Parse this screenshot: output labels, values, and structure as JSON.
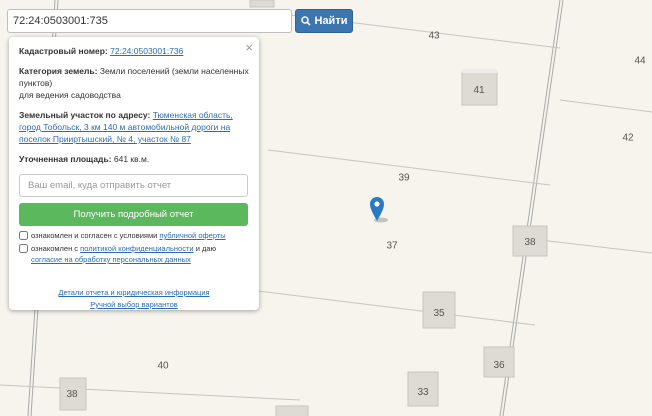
{
  "search": {
    "value": "72:24:0503001:735",
    "button_label": "Найти"
  },
  "popup": {
    "cadastral_label": "Кадастровый номер:",
    "cadastral_value": "72:24:0503001:736",
    "category_label": "Категория земель:",
    "category_value": "Земли поселений (земли населенных пунктов)",
    "category_usage": "для ведения садоводства",
    "address_label": "Земельный участок по адресу:",
    "address_value": "Тюменская область, город Тобольск, 3 км 140 м автомобильной дороги на поселок Прииртышский, № 4, участок № 87",
    "area_label": "Уточненная площадь:",
    "area_value": "641 кв.м.",
    "email_placeholder": "Ваш email, куда отправить отчет",
    "report_button": "Получить подробный отчет",
    "check1_text": "ознакомлен и согласен с условиями",
    "check1_link": "публичной оферты",
    "check2_text": "ознакомлен с",
    "check2_link": "политикой конфиденциальности",
    "check2_middle": "и даю",
    "check2_link2": "согласие на обработку персональных данных",
    "link_details": "Детали отчета и юридическая информация",
    "link_manual": "Ручной выбор вариантов"
  },
  "map": {
    "plot_numbers": [
      "43",
      "44",
      "42",
      "39",
      "37",
      "40"
    ],
    "building_numbers": [
      "41",
      "38",
      "35",
      "36",
      "33",
      "38"
    ],
    "marker_color": "#2a7bc4"
  }
}
